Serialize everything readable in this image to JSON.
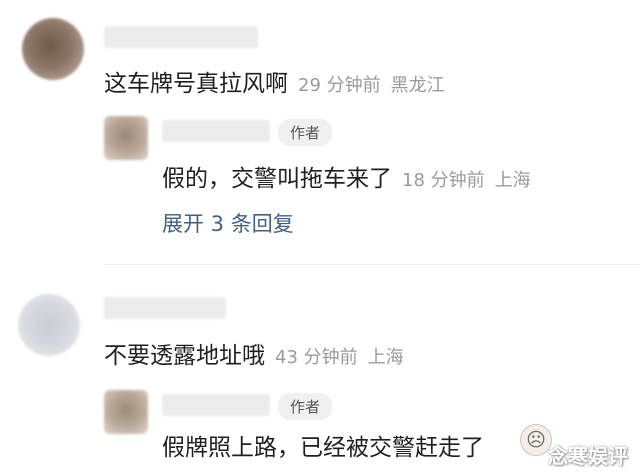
{
  "comments": [
    {
      "text": "这车牌号真拉风啊",
      "time": "29 分钟前",
      "location": "黑龙江",
      "reply": {
        "badge": "作者",
        "text": "假的，交警叫拖车来了",
        "time": "18 分钟前",
        "location": "上海"
      },
      "expand_label": "展开 3 条回复"
    },
    {
      "text": "不要透露地址哦",
      "time": "43 分钟前",
      "location": "上海",
      "reply": {
        "badge": "作者",
        "text": "假牌照上路，已经被交警赶走了"
      }
    }
  ],
  "watermark": "念寒娱评",
  "emoji_icon": "crying-face-icon",
  "colors": {
    "link": "#3f5f86",
    "meta": "#9a9a9a",
    "badge_bg": "#f0f0f0"
  }
}
